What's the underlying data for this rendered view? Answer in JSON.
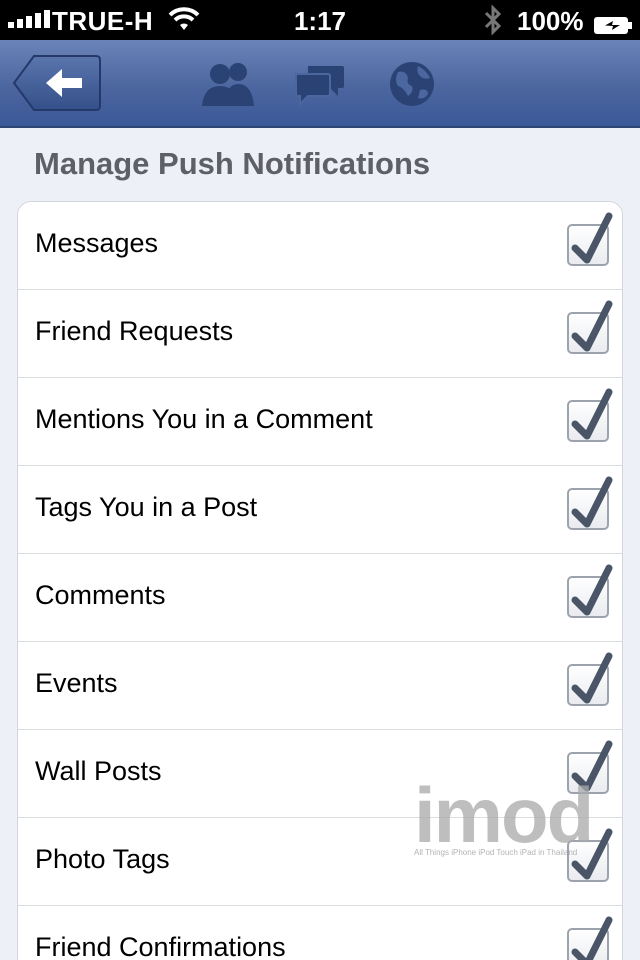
{
  "status_bar": {
    "carrier": "TRUE-H",
    "time": "1:17",
    "battery": "100%"
  },
  "nav_bar": {
    "icons": [
      "back-arrow-icon",
      "friends-icon",
      "messages-icon",
      "globe-icon"
    ]
  },
  "page": {
    "title": "Manage Push Notifications"
  },
  "settings": [
    {
      "label": "Messages",
      "checked": true
    },
    {
      "label": "Friend Requests",
      "checked": true
    },
    {
      "label": "Mentions You in a Comment",
      "checked": true
    },
    {
      "label": "Tags You in a Post",
      "checked": true
    },
    {
      "label": "Comments",
      "checked": true
    },
    {
      "label": "Events",
      "checked": true
    },
    {
      "label": "Wall Posts",
      "checked": true
    },
    {
      "label": "Photo Tags",
      "checked": true
    },
    {
      "label": "Friend Confirmations",
      "checked": true
    }
  ],
  "watermark": {
    "logo": "imod",
    "tagline": "All Things iPhone iPod Touch iPad in Thailand"
  },
  "colors": {
    "nav": "#3b5998",
    "checkmark": "#4a5568"
  }
}
